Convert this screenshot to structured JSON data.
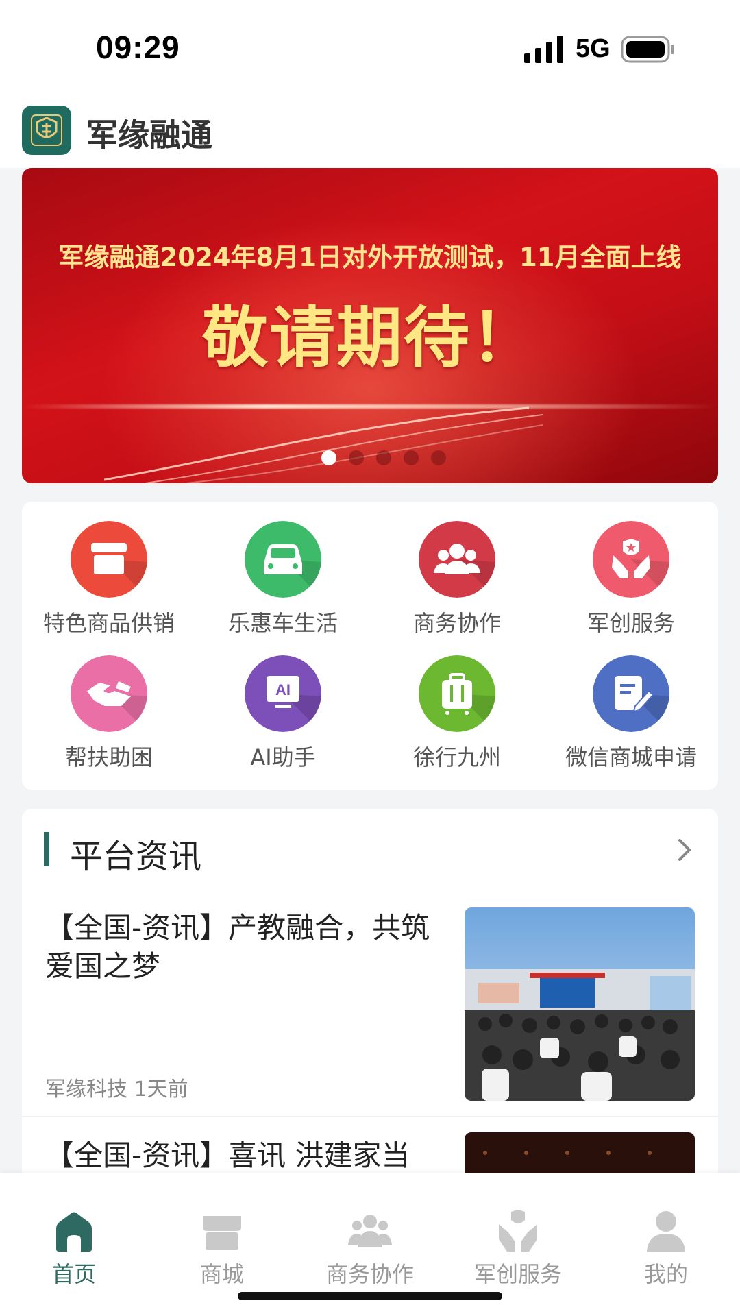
{
  "status_bar": {
    "time": "09:29",
    "network": "5G",
    "signal_icon": "signal-bars-icon",
    "battery_icon": "battery-icon"
  },
  "app": {
    "title": "军缘融通",
    "logo_icon": "app-logo-icon"
  },
  "banner": {
    "subtitle": "军缘融通2024年8月1日对外开放测试，11月全面上线",
    "title": "敬请期待！",
    "slide_count": 5,
    "active_slide": 1
  },
  "features": [
    {
      "label": "特色商品供销",
      "icon": "store-icon",
      "color": "#ec4b3c"
    },
    {
      "label": "乐惠车生活",
      "icon": "car-icon",
      "color": "#3dbb6a"
    },
    {
      "label": "商务协作",
      "icon": "business-people-icon",
      "color": "#d23a48"
    },
    {
      "label": "军创服务",
      "icon": "hands-star-icon",
      "color": "#ef5a6c"
    },
    {
      "label": "帮扶助困",
      "icon": "handshake-icon",
      "color": "#ea6fa7"
    },
    {
      "label": "AI助手",
      "icon": "ai-assistant-icon",
      "color": "#7d4fb8"
    },
    {
      "label": "徐行九州",
      "icon": "luggage-icon",
      "color": "#6cb830"
    },
    {
      "label": "微信商城申请",
      "icon": "edit-document-icon",
      "color": "#4e6fc4"
    }
  ],
  "news": {
    "section_title": "平台资讯",
    "more_icon": "chevron-right-icon",
    "items": [
      {
        "title": "【全国-资讯】产教融合，共筑爱国之梦",
        "source": "军缘科技",
        "time": "1天前",
        "thumb": "conference-hall-photo"
      },
      {
        "title": "【全国-资讯】喜讯 洪建家当",
        "thumb": "stage-photo"
      }
    ]
  },
  "tabs": [
    {
      "label": "首页",
      "icon": "home-icon",
      "active": true
    },
    {
      "label": "商城",
      "icon": "store-icon",
      "active": false
    },
    {
      "label": "商务协作",
      "icon": "business-people-icon",
      "active": false
    },
    {
      "label": "军创服务",
      "icon": "hands-star-icon",
      "active": false
    },
    {
      "label": "我的",
      "icon": "profile-icon",
      "active": false
    }
  ],
  "colors": {
    "brand": "#2e6a62",
    "banner_red": "#d31219",
    "banner_gold": "#ffe783"
  }
}
